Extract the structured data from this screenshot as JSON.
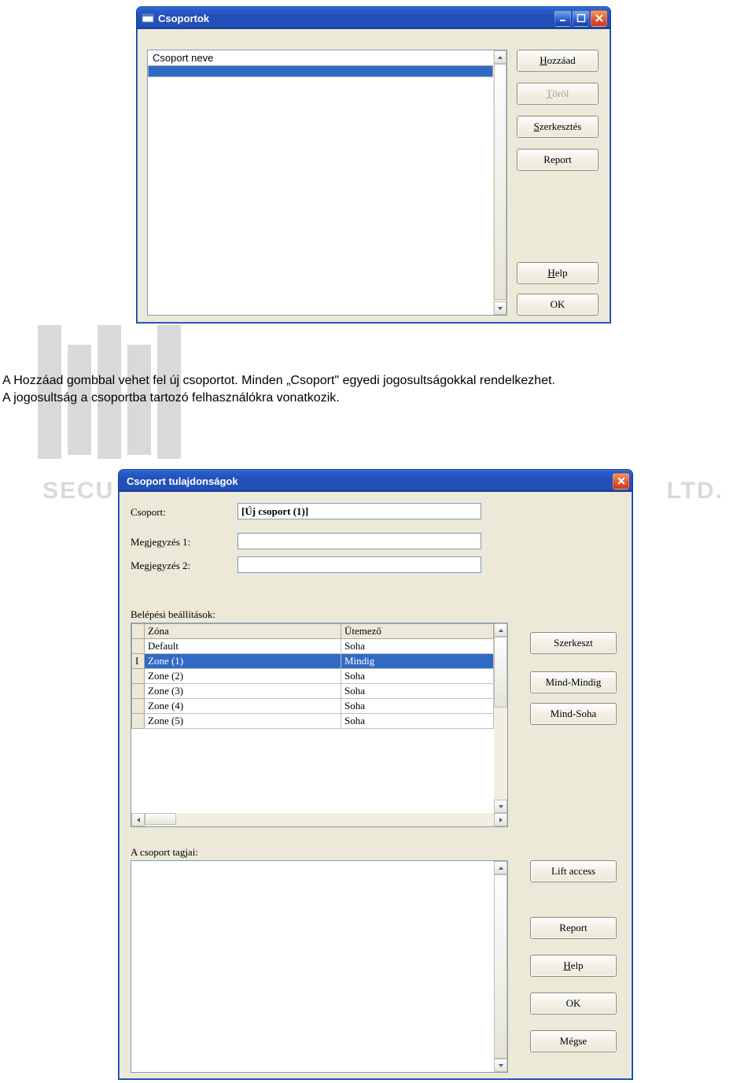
{
  "doc_text": {
    "line1": "A Hozzáad gombbal vehet fel új csoportot. Minden „Csoport\" egyedi jogosultságokkal rendelkezhet.",
    "line2": "A jogosultság a csoportba tartozó felhasználókra vonatkozik."
  },
  "watermark": {
    "left": "SECU",
    "right": "LTD."
  },
  "win1": {
    "title": "Csoportok",
    "list_header": "Csoport neve",
    "buttons": {
      "add": "Hozzáad",
      "delete": "Töröl",
      "edit": "Szerkesztés",
      "report": "Report",
      "help": "Help",
      "ok": "OK"
    }
  },
  "win2": {
    "title": "Csoport tulajdonságok",
    "labels": {
      "group": "Csoport:",
      "note1": "Megjegyzés 1:",
      "note2": "Megjegyzés 2:",
      "access": "Belépési beállítások:",
      "members": "A csoport tagjai:"
    },
    "fields": {
      "group": "[Új csoport (1)]",
      "note1": "",
      "note2": ""
    },
    "grid": {
      "col_zone": "Zóna",
      "col_sched": "Ütemező",
      "rows": [
        {
          "zone": "Default",
          "sched": "Soha"
        },
        {
          "zone": "Zone  (1)",
          "sched": "Mindig"
        },
        {
          "zone": "Zone (2)",
          "sched": "Soha"
        },
        {
          "zone": "Zone (3)",
          "sched": "Soha"
        },
        {
          "zone": "Zone (4)",
          "sched": "Soha"
        },
        {
          "zone": "Zone (5)",
          "sched": "Soha"
        }
      ],
      "selected_index": 1
    },
    "buttons": {
      "edit": "Szerkeszt",
      "all_always": "Mind-Mindig",
      "all_never": "Mind-Soha",
      "lift": "Lift access",
      "report": "Report",
      "help": "Help",
      "ok": "OK",
      "cancel": "Mégse"
    }
  }
}
